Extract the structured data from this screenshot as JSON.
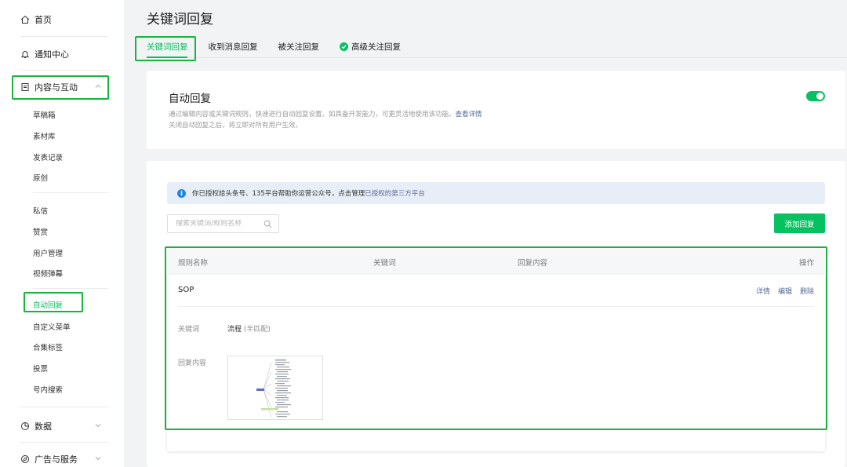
{
  "sidebar": {
    "home": "首页",
    "notifications": "通知中心",
    "content_group": "内容与互动",
    "content_items": [
      "草稿箱",
      "素材库",
      "发表记录",
      "原创"
    ],
    "interaction_items": [
      "私信",
      "赞赏",
      "用户管理",
      "视频弹幕"
    ],
    "feature_items": [
      "自动回复",
      "自定义菜单",
      "合集标签",
      "投票",
      "号内搜索"
    ],
    "data": "数据",
    "ads": "广告与服务"
  },
  "header": {
    "title": "关键词回复",
    "tabs": [
      "关键词回复",
      "收到消息回复",
      "被关注回复",
      "高级关注回复"
    ]
  },
  "auto_reply": {
    "title": "自动回复",
    "desc1": "通过编辑内容或关键词规则，快速进行自动回复设置。如具备开发能力，可更灵活地使用该功能。",
    "desc_link": "查看详情",
    "desc2": "关闭自动回复之后，将立即对所有用户生效。",
    "enabled": true
  },
  "notice": {
    "text": "你已授权给头条号、135平台帮助你运营公众号，点击管理",
    "link": "已授权的第三方平台"
  },
  "search": {
    "placeholder": "搜索关键词/规则名称"
  },
  "add_button": "添加回复",
  "table": {
    "columns": [
      "规则名称",
      "关键词",
      "回复内容",
      "操作"
    ],
    "rule": {
      "name": "SOP",
      "actions": [
        "详情",
        "编辑",
        "删除"
      ],
      "keyword_label": "关键词",
      "keyword_value": "流程",
      "match_type": "(半匹配)",
      "reply_label": "回复内容"
    }
  },
  "colors": {
    "accent": "#07c160",
    "highlight": "#17b53d",
    "link": "#576b95"
  }
}
